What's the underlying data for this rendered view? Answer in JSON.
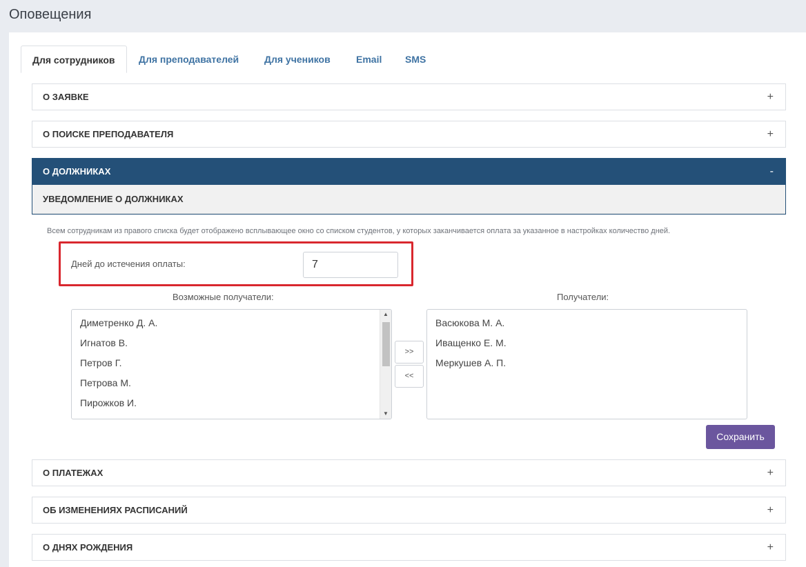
{
  "page": {
    "title": "Оповещения"
  },
  "tabs": [
    {
      "label": "Для сотрудников"
    },
    {
      "label": "Для преподавателей"
    },
    {
      "label": "Для учеников"
    },
    {
      "label": "Email"
    },
    {
      "label": "SMS"
    }
  ],
  "sections": {
    "s1": {
      "title": "О ЗАЯВКЕ",
      "sign": "+"
    },
    "s2": {
      "title": "О ПОИСКЕ ПРЕПОДАВАТЕЛЯ",
      "sign": "+"
    },
    "s3": {
      "title": "О ДОЛЖНИКАХ",
      "sign": "-"
    },
    "s4": {
      "title": "О ПЛАТЕЖАХ",
      "sign": "+"
    },
    "s5": {
      "title": "ОБ ИЗМЕНЕНИЯХ РАСПИСАНИЙ",
      "sign": "+"
    },
    "s6": {
      "title": "О ДНЯХ РОЖДЕНИЯ",
      "sign": "+"
    }
  },
  "debtors": {
    "subheading": "УВЕДОМЛЕНИЕ О ДОЛЖНИКАХ",
    "description": "Всем сотрудникам из правого списка будет отображено всплывающее окно со списком студентов, у которых заканчивается оплата за указанное в настройках количество дней.",
    "days_label": "Дней до истечения оплаты:",
    "days_value": "7",
    "available_title": "Возможные получатели:",
    "recipients_title": "Получатели:",
    "available": [
      "Диметренко Д. А.",
      "Игнатов В.",
      "Петров Г.",
      "Петрова М.",
      "Пирожков И."
    ],
    "recipients": [
      "Васюкова М. А.",
      "Иващенко Е. М.",
      "Меркушев А. П."
    ],
    "add_label": ">>",
    "remove_label": "<<",
    "save_label": "Сохранить"
  },
  "colors": {
    "accent": "#245078",
    "save_button": "#6b569e",
    "highlight": "#d9272e",
    "tab_link": "#3f73a3"
  }
}
